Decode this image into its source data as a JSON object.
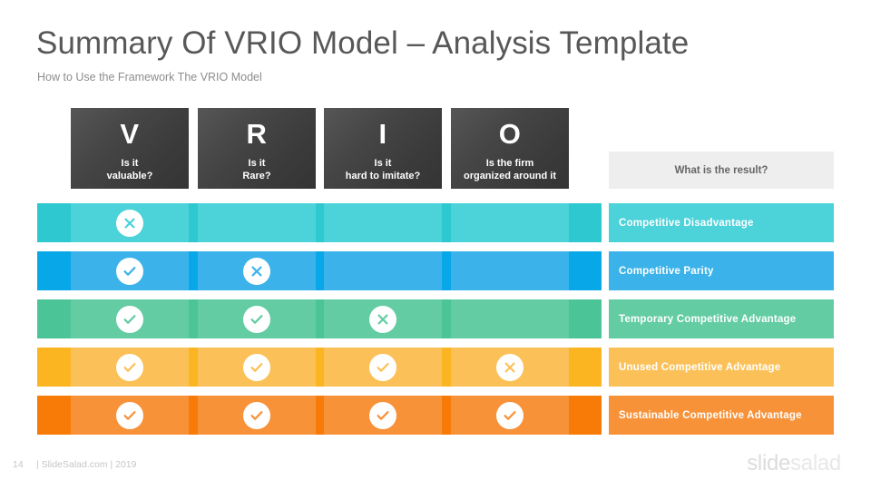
{
  "title": "Summary Of VRIO Model – Analysis Template",
  "subtitle": "How to Use the Framework The VRIO Model",
  "columns": [
    {
      "letter": "V",
      "question_line1": "Is it",
      "question_line2": "valuable?"
    },
    {
      "letter": "R",
      "question_line1": "Is it",
      "question_line2": "Rare?"
    },
    {
      "letter": "I",
      "question_line1": "Is it",
      "question_line2": "hard to imitate?"
    },
    {
      "letter": "O",
      "question_line1": "Is the firm",
      "question_line2": "organized around  it"
    }
  ],
  "result_header": "What is the result?",
  "rows": [
    {
      "result": "Competitive Disadvantage",
      "color": "#4CD2D9",
      "color_dark": "#2DC8D0",
      "marks": [
        "cross",
        "none",
        "none",
        "none"
      ]
    },
    {
      "result": "Competitive Parity",
      "color": "#3BB3EA",
      "color_dark": "#08A7E8",
      "marks": [
        "check",
        "cross",
        "none",
        "none"
      ]
    },
    {
      "result": "Temporary Competitive Advantage",
      "color": "#63CCA3",
      "color_dark": "#4BC598",
      "marks": [
        "check",
        "check",
        "cross",
        "none"
      ]
    },
    {
      "result": "Unused Competitive Advantage",
      "color": "#FBC158",
      "color_dark": "#FBB521",
      "marks": [
        "check",
        "check",
        "check",
        "cross"
      ]
    },
    {
      "result": "Sustainable Competitive Advantage",
      "color": "#F79239",
      "color_dark": "#F97B07",
      "marks": [
        "check",
        "check",
        "check",
        "check"
      ]
    }
  ],
  "footer": {
    "page_number": "14",
    "credit": "| SlideSalad.com | 2019",
    "logo_part1": "slide",
    "logo_part2": "salad"
  }
}
